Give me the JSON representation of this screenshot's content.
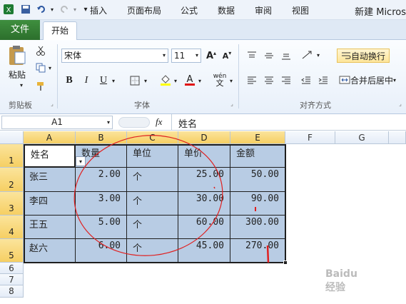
{
  "window": {
    "title": "新建 Micros"
  },
  "quick_access": {
    "app_icon": "excel-icon",
    "save_icon": "save-icon",
    "undo_icon": "undo-icon",
    "redo_icon": "redo-icon",
    "customize_icon": "customize-icon"
  },
  "tabs": {
    "file": "文件",
    "home": "开始",
    "insert": "插入",
    "page_layout": "页面布局",
    "formulas": "公式",
    "data": "数据",
    "review": "审阅",
    "view": "视图"
  },
  "clipboard": {
    "paste": "粘贴",
    "label": "剪贴板"
  },
  "font": {
    "name": "宋体",
    "size": "11",
    "bold": "B",
    "italic": "I",
    "underline": "U",
    "label": "字体",
    "phonetic": "wén"
  },
  "alignment": {
    "wrap": "自动换行",
    "merge": "合并后居中",
    "label": "对齐方式"
  },
  "formula_bar": {
    "name_box": "A1",
    "fx": "fx",
    "content": "姓名"
  },
  "columns": [
    "A",
    "B",
    "C",
    "D",
    "E",
    "F",
    "G"
  ],
  "rows": [
    "1",
    "2",
    "3",
    "4",
    "5",
    "6",
    "7",
    "8"
  ],
  "table": {
    "headers": [
      "姓名",
      "数量",
      "单位",
      "单价",
      "金额"
    ],
    "rows": [
      [
        "张三",
        "2.00",
        "个",
        "25.00",
        "50.00"
      ],
      [
        "李四",
        "3.00",
        "个",
        "30.00",
        "90.00"
      ],
      [
        "王五",
        "5.00",
        "个",
        "60.00",
        "300.00"
      ],
      [
        "赵六",
        "6.00",
        "个",
        "45.00",
        "270.00"
      ]
    ]
  },
  "watermark": {
    "text": "Baidu 经验"
  },
  "colors": {
    "selection": "#b8cce4",
    "file_tab": "#2c6f2c",
    "annotation": "#e02020"
  }
}
